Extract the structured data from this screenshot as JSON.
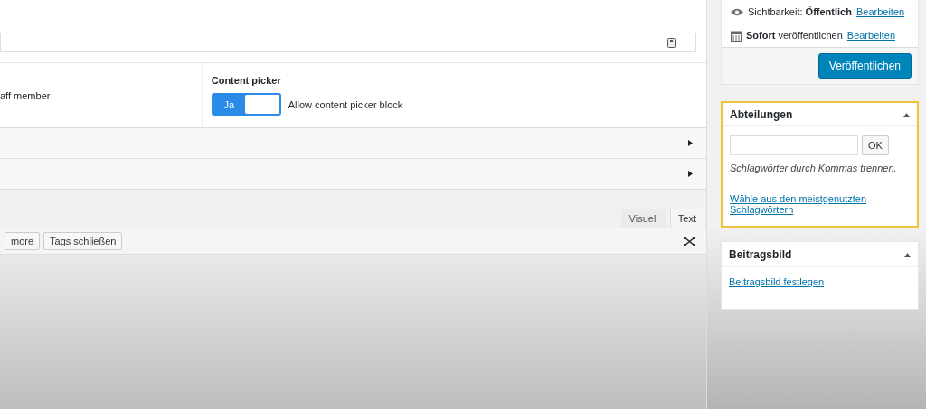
{
  "fields": [
    {
      "kind": "text",
      "description": "aff member"
    },
    {
      "kind": "toggle",
      "label": "Content picker",
      "toggle_label": "Ja",
      "on": true,
      "description": "Allow content picker block"
    }
  ],
  "collapsed_sections": [
    {
      "expanded": false
    },
    {
      "expanded": false
    }
  ],
  "editor": {
    "tabs": [
      {
        "label": "Visuell",
        "selected": false
      },
      {
        "label": "Text",
        "selected": true
      }
    ],
    "buttons": [
      "more",
      "Tags schließen"
    ]
  },
  "publish": {
    "visibility": "Sichtbarkeit: **Öffentlich**",
    "schedule": "**Sofort** veröffentlichen",
    "edit_links": [
      "Bearbeiten",
      "Bearbeiten"
    ],
    "button": "Veröffentlichen"
  },
  "boxes": [
    {
      "kind": "tags",
      "title": "Abteilungen",
      "highlighted": true,
      "expanded": true,
      "button": "OK",
      "hint": "Schlagwörter durch Kommas trennen.",
      "link": "Wähle aus den meistgenutzten Schlagwörtern"
    },
    {
      "kind": "image",
      "title": "Beitragsbild",
      "highlighted": false,
      "expanded": true,
      "link": "Beitragsbild festlegen"
    }
  ]
}
